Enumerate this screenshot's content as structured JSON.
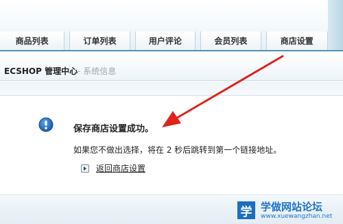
{
  "nav": {
    "tabs": [
      {
        "label": "商品列表"
      },
      {
        "label": "订单列表"
      },
      {
        "label": "用户评论"
      },
      {
        "label": "会员列表"
      },
      {
        "label": "商店设置"
      }
    ]
  },
  "header": {
    "title": "ECSHOP 管理中心",
    "subtitle": "- 系统信息"
  },
  "message": {
    "icon": "info-icon",
    "title": "保存商店设置成功。",
    "detail": "如果您不做出选择，将在 2 秒后跳转到第一个链接地址。",
    "link_label": "返回商店设置"
  },
  "annotation": {
    "arrow_color": "#e0231b"
  },
  "watermark": {
    "logo_char": "学",
    "name": "学做网站论坛",
    "url": "www.xuewangzhan.net"
  },
  "colors": {
    "accent": "#4e91b3",
    "info_blue": "#1f6fc5"
  }
}
